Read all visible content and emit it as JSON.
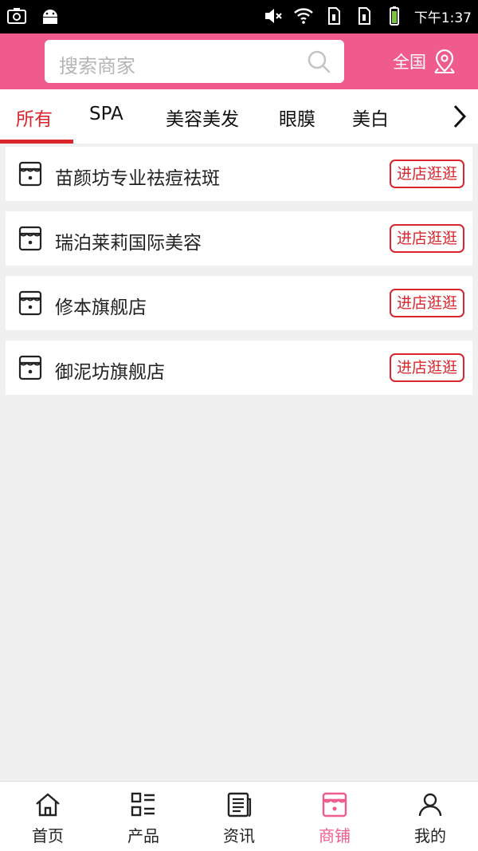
{
  "status_bar": {
    "time": "下午1:37"
  },
  "header": {
    "search_placeholder": "搜索商家",
    "region_label": "全国"
  },
  "tabs": [
    "所有",
    "SPA",
    "美容美发",
    "眼膜",
    "美白"
  ],
  "shops": [
    {
      "name": "苗颜坊专业祛痘祛斑",
      "button": "进店逛逛"
    },
    {
      "name": "瑞泊莱莉国际美容",
      "button": "进店逛逛"
    },
    {
      "name": "修本旗舰店",
      "button": "进店逛逛"
    },
    {
      "name": "御泥坊旗舰店",
      "button": "进店逛逛"
    }
  ],
  "bottom_nav": [
    {
      "label": "首页",
      "icon": "home-icon"
    },
    {
      "label": "产品",
      "icon": "product-grid-icon"
    },
    {
      "label": "资讯",
      "icon": "news-icon"
    },
    {
      "label": "商铺",
      "icon": "store-icon",
      "active": true
    },
    {
      "label": "我的",
      "icon": "user-icon"
    }
  ],
  "colors": {
    "brand": "#ef5b8c",
    "accent": "#d9262c"
  }
}
